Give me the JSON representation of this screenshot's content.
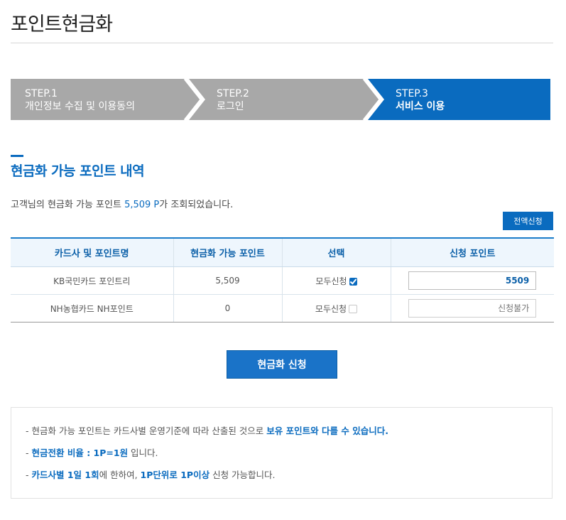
{
  "page": {
    "title": "포인트현금화"
  },
  "steps": [
    {
      "num": "STEP.1",
      "label": "개인정보 수집 및 이용동의",
      "state": "done"
    },
    {
      "num": "STEP.2",
      "label": "로그인",
      "state": "done"
    },
    {
      "num": "STEP.3",
      "label": "서비스 이용",
      "state": "active"
    }
  ],
  "colors": {
    "accent": "#0a6bbf",
    "step_inactive": "#a8a8a8",
    "step_active": "#0a6bbf",
    "header_bg": "#eef6fd"
  },
  "section": {
    "title": "현금화 가능 포인트 내역"
  },
  "summary": {
    "prefix": "고객님의 현금화 가능 포인트 ",
    "amount": "5,509 P",
    "suffix": "가 조회되었습니다."
  },
  "buttons": {
    "apply_all": "전액신청",
    "apply": "현금화 신청"
  },
  "table": {
    "headers": [
      "카드사 및 포인트명",
      "현금화 가능 포인트",
      "선택",
      "신청 포인트"
    ],
    "rows": [
      {
        "name": "KB국민카드 포인트리",
        "points": "5,509",
        "select_label": "모두신청",
        "checked": true,
        "request_value": "5509",
        "request_placeholder": ""
      },
      {
        "name": "NH농협카드 NH포인트",
        "points": "0",
        "select_label": "모두신청",
        "checked": false,
        "request_value": "",
        "request_placeholder": "신청불가"
      }
    ]
  },
  "notice": {
    "line1": {
      "text": "- 현금화 가능 포인트는 카드사별 운영기준에 따라 산출된 것으로 ",
      "hl": "보유 포인트와 다를 수 있습니다."
    },
    "line2": {
      "dash": "- ",
      "hl": "현금전환 비율 : 1P=1원",
      "text": " 입니다."
    },
    "line3": {
      "dash": "- ",
      "hl1": "카드사별 1일 1회",
      "text1": "에 한하여, ",
      "hl2": "1P단위로 1P이상",
      "text2": " 신청 가능합니다."
    }
  }
}
